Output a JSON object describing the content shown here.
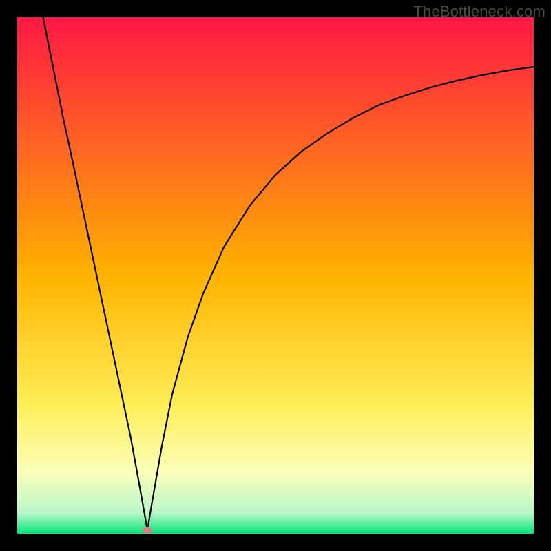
{
  "watermark": "TheBottleneck.com",
  "chart_data": {
    "type": "line",
    "title": "",
    "xlabel": "",
    "ylabel": "",
    "xlim": [
      0,
      100
    ],
    "ylim": [
      0,
      100
    ],
    "grid": false,
    "legend": false,
    "gradient_stops": [
      {
        "offset": 0.0,
        "color": "#ff1744"
      },
      {
        "offset": 0.5,
        "color": "#ffb300"
      },
      {
        "offset": 0.75,
        "color": "#ffee58"
      },
      {
        "offset": 0.88,
        "color": "#fbffb8"
      },
      {
        "offset": 0.96,
        "color": "#b9f6ca"
      },
      {
        "offset": 1.0,
        "color": "#00e676"
      }
    ],
    "minimum_marker": {
      "x": 25.2,
      "y": 0.7,
      "color": "#d88084"
    },
    "series": [
      {
        "name": "bottleneck-curve",
        "color": "#000000",
        "x": [
          5,
          6,
          7,
          8,
          9,
          10,
          12,
          14,
          16,
          18,
          20,
          22,
          24,
          25.2,
          26,
          28,
          30,
          33,
          36,
          40,
          45,
          50,
          55,
          60,
          65,
          70,
          75,
          80,
          85,
          90,
          95,
          100
        ],
        "y": [
          100,
          95,
          90,
          85,
          80,
          75.5,
          66,
          56.5,
          47,
          37.5,
          28,
          18.5,
          7.5,
          0.7,
          5.5,
          17,
          27,
          38,
          46.5,
          55.5,
          63.5,
          69.5,
          74,
          77.5,
          80.5,
          83,
          84.8,
          86.4,
          87.7,
          88.8,
          89.7,
          90.4
        ]
      }
    ]
  }
}
